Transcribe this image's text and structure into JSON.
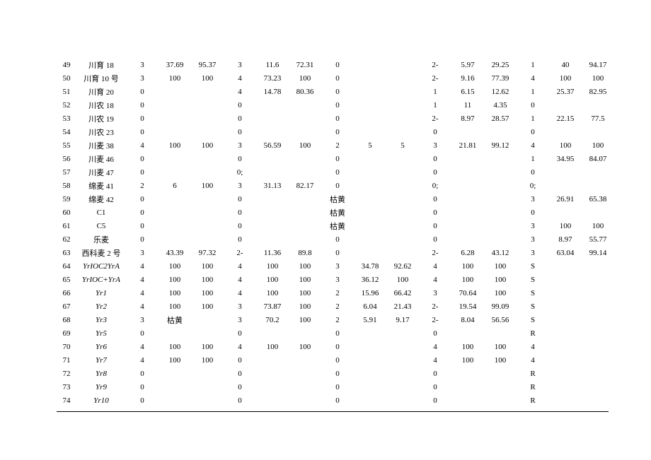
{
  "rows": [
    {
      "idx": "49",
      "name": "川育 18",
      "c": [
        "3",
        "37.69",
        "95.37",
        "3",
        "11.6",
        "72.31",
        "0",
        "",
        "",
        "2-",
        "5.97",
        "29.25",
        "1",
        "40",
        "94.17"
      ]
    },
    {
      "idx": "50",
      "name": "川育 10 号",
      "c": [
        "3",
        "100",
        "100",
        "4",
        "73.23",
        "100",
        "0",
        "",
        "",
        "2-",
        "9.16",
        "77.39",
        "4",
        "100",
        "100"
      ]
    },
    {
      "idx": "51",
      "name": "川育 20",
      "c": [
        "0",
        "",
        "",
        "4",
        "14.78",
        "80.36",
        "0",
        "",
        "",
        "1",
        "6.15",
        "12.62",
        "1",
        "25.37",
        "82.95"
      ]
    },
    {
      "idx": "52",
      "name": "川农 18",
      "c": [
        "0",
        "",
        "",
        "0",
        "",
        "",
        "0",
        "",
        "",
        "1",
        "11",
        "4.35",
        "0",
        "",
        ""
      ]
    },
    {
      "idx": "53",
      "name": "川农 19",
      "c": [
        "0",
        "",
        "",
        "0",
        "",
        "",
        "0",
        "",
        "",
        "2-",
        "8.97",
        "28.57",
        "1",
        "22.15",
        "77.5"
      ]
    },
    {
      "idx": "54",
      "name": "川农 23",
      "c": [
        "0",
        "",
        "",
        "0",
        "",
        "",
        "0",
        "",
        "",
        "0",
        "",
        "",
        "0",
        "",
        ""
      ]
    },
    {
      "idx": "55",
      "name": "川麦 38",
      "c": [
        "4",
        "100",
        "100",
        "3",
        "56.59",
        "100",
        "2",
        "5",
        "5",
        "3",
        "21.81",
        "99.12",
        "4",
        "100",
        "100"
      ]
    },
    {
      "idx": "56",
      "name": "川麦 46",
      "c": [
        "0",
        "",
        "",
        "0",
        "",
        "",
        "0",
        "",
        "",
        "0",
        "",
        "",
        "1",
        "34.95",
        "84.07"
      ]
    },
    {
      "idx": "57",
      "name": "川麦 47",
      "c": [
        "0",
        "",
        "",
        "0;",
        "",
        "",
        "0",
        "",
        "",
        "0",
        "",
        "",
        "0",
        "",
        ""
      ]
    },
    {
      "idx": "58",
      "name": "绵麦 41",
      "c": [
        "2",
        "6",
        "100",
        "3",
        "31.13",
        "82.17",
        "0",
        "",
        "",
        "0;",
        "",
        "",
        "0;",
        "",
        ""
      ]
    },
    {
      "idx": "59",
      "name": "绵麦 42",
      "c": [
        "0",
        "",
        "",
        "0",
        "",
        "",
        "枯黄",
        "",
        "",
        "0",
        "",
        "",
        "3",
        "26.91",
        "65.38"
      ]
    },
    {
      "idx": "60",
      "name": "C1",
      "c": [
        "0",
        "",
        "",
        "0",
        "",
        "",
        "枯黄",
        "",
        "",
        "0",
        "",
        "",
        "0",
        "",
        ""
      ]
    },
    {
      "idx": "61",
      "name": "C5",
      "c": [
        "0",
        "",
        "",
        "0",
        "",
        "",
        "枯黄",
        "",
        "",
        "0",
        "",
        "",
        "3",
        "100",
        "100"
      ]
    },
    {
      "idx": "62",
      "name": "乐麦",
      "c": [
        "0",
        "",
        "",
        "0",
        "",
        "",
        "0",
        "",
        "",
        "0",
        "",
        "",
        "3",
        "8.97",
        "55.77"
      ]
    },
    {
      "idx": "63",
      "name": "西科麦 2 号",
      "c": [
        "3",
        "43.39",
        "97.32",
        "2-",
        "11.36",
        "89.8",
        "0",
        "",
        "",
        "2-",
        "6.28",
        "43.12",
        "3",
        "63.04",
        "99.14"
      ]
    },
    {
      "idx": "64",
      "name": "YrIOC2YrA",
      "italic": true,
      "c": [
        "4",
        "100",
        "100",
        "4",
        "100",
        "100",
        "3",
        "34.78",
        "92.62",
        "4",
        "100",
        "100",
        "S",
        "",
        ""
      ]
    },
    {
      "idx": "65",
      "name": "YrIOC+YrA",
      "italic": true,
      "c": [
        "4",
        "100",
        "100",
        "4",
        "100",
        "100",
        "3",
        "36.12",
        "100",
        "4",
        "100",
        "100",
        "S",
        "",
        ""
      ]
    },
    {
      "idx": "66",
      "name": "Yr1",
      "italic": true,
      "c": [
        "4",
        "100",
        "100",
        "4",
        "100",
        "100",
        "2",
        "15.96",
        "66.42",
        "3",
        "70.64",
        "100",
        "S",
        "",
        ""
      ]
    },
    {
      "idx": "67",
      "name": "Yr2",
      "italic": true,
      "c": [
        "4",
        "100",
        "100",
        "3",
        "73.87",
        "100",
        "2",
        "6.04",
        "21.43",
        "2-",
        "19.54",
        "99.09",
        "S",
        "",
        ""
      ]
    },
    {
      "idx": "68",
      "name": "Yr3",
      "italic": true,
      "c": [
        "3",
        "枯黄",
        "",
        "3",
        "70.2",
        "100",
        "2",
        "5.91",
        "9.17",
        "2-",
        "8.04",
        "56.56",
        "S",
        "",
        ""
      ]
    },
    {
      "idx": "69",
      "name": "Yr5",
      "italic": true,
      "c": [
        "0",
        "",
        "",
        "0",
        "",
        "",
        "0",
        "",
        "",
        "0",
        "",
        "",
        "R",
        "",
        ""
      ]
    },
    {
      "idx": "70",
      "name": "Yr6",
      "italic": true,
      "c": [
        "4",
        "100",
        "100",
        "4",
        "100",
        "100",
        "0",
        "",
        "",
        "4",
        "100",
        "100",
        "4",
        "",
        ""
      ]
    },
    {
      "idx": "71",
      "name": "Yr7",
      "italic": true,
      "c": [
        "4",
        "100",
        "100",
        "0",
        "",
        "",
        "0",
        "",
        "",
        "4",
        "100",
        "100",
        "4",
        "",
        ""
      ]
    },
    {
      "idx": "72",
      "name": "Yr8",
      "italic": true,
      "c": [
        "0",
        "",
        "",
        "0",
        "",
        "",
        "0",
        "",
        "",
        "0",
        "",
        "",
        "R",
        "",
        ""
      ]
    },
    {
      "idx": "73",
      "name": "Yr9",
      "italic": true,
      "c": [
        "0",
        "",
        "",
        "0",
        "",
        "",
        "0",
        "",
        "",
        "0",
        "",
        "",
        "R",
        "",
        ""
      ]
    },
    {
      "idx": "74",
      "name": "Yr10",
      "italic": true,
      "c": [
        "0",
        "",
        "",
        "0",
        "",
        "",
        "0",
        "",
        "",
        "0",
        "",
        "",
        "R",
        "",
        ""
      ]
    }
  ]
}
